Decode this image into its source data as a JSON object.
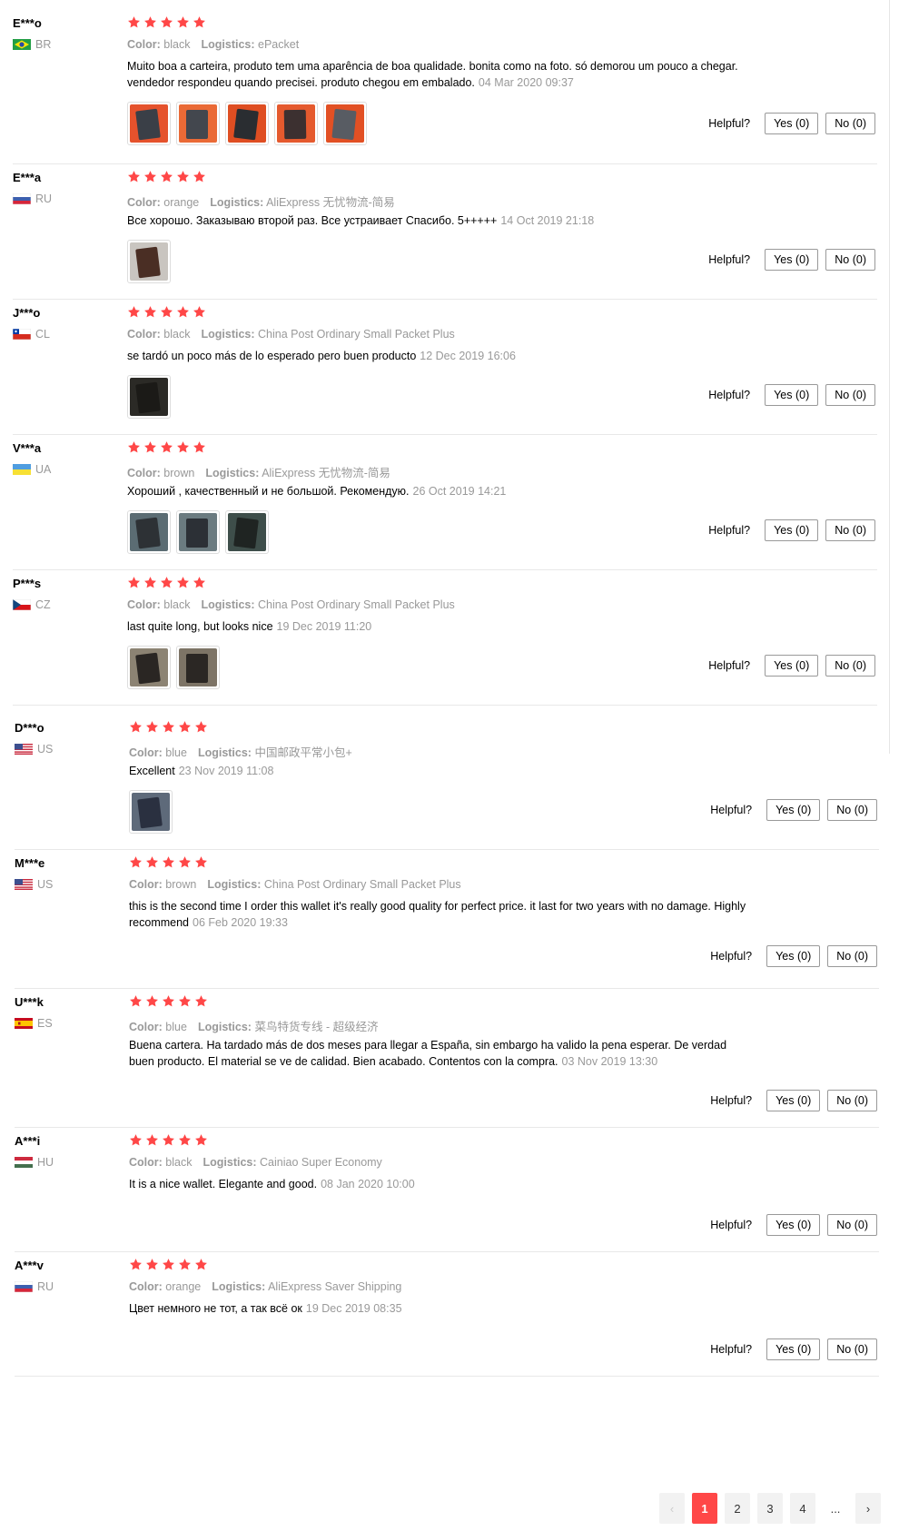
{
  "colors": {
    "accent": "#ff4747",
    "star": "#ff4747",
    "muted": "#999999"
  },
  "labels": {
    "color": "Color:",
    "logistics": "Logistics:",
    "helpful": "Helpful?"
  },
  "reviews": [
    {
      "user": "E***o",
      "country": "BR",
      "color": "black",
      "logistics": "ePacket",
      "text": "Muito boa a carteira, produto tem uma aparência de boa qualidade. bonita como na foto. só demorou um pouco a chegar. vendedor respondeu quando precisei. produto chegou em embalado.",
      "date": "04 Mar 2020 09:37",
      "photos": 5,
      "yes": "Yes (0)",
      "no": "No (0)",
      "rating": 5
    },
    {
      "user": "E***a",
      "country": "RU",
      "color": "orange",
      "logistics": "AliExpress 无忧物流-简易",
      "text": "Все хорошо. Заказываю второй раз. Все устраивает Спасибо. 5+++++",
      "date": "14 Oct 2019 21:18",
      "photos": 1,
      "yes": "Yes (0)",
      "no": "No (0)",
      "rating": 5
    },
    {
      "user": "J***o",
      "country": "CL",
      "color": "black",
      "logistics": "China Post Ordinary Small Packet Plus",
      "text": "se tardó un poco más de lo esperado pero buen producto",
      "date": "12 Dec 2019 16:06",
      "photos": 1,
      "yes": "Yes (0)",
      "no": "No (0)",
      "rating": 5
    },
    {
      "user": "V***a",
      "country": "UA",
      "color": "brown",
      "logistics": "AliExpress 无忧物流-简易",
      "text": "Хороший , качественный и не большой. Рекомендую.",
      "date": "26 Oct 2019 14:21",
      "photos": 3,
      "yes": "Yes (0)",
      "no": "No (0)",
      "rating": 5
    },
    {
      "user": "P***s",
      "country": "CZ",
      "color": "black",
      "logistics": "China Post Ordinary Small Packet Plus",
      "text": "last quite long, but looks nice",
      "date": "19 Dec 2019 11:20",
      "photos": 2,
      "yes": "Yes (0)",
      "no": "No (0)",
      "rating": 5
    },
    {
      "user": "D***o",
      "country": "US",
      "color": "blue",
      "logistics": "中国邮政平常小包+",
      "text": "Excellent",
      "date": "23 Nov 2019 11:08",
      "photos": 1,
      "yes": "Yes (0)",
      "no": "No (0)",
      "rating": 5
    },
    {
      "user": "M***e",
      "country": "US",
      "color": "brown",
      "logistics": "China Post Ordinary Small Packet Plus",
      "text": "this is the second time I order this wallet it's really good quality for perfect price. it last for two years with no damage. Highly recommend",
      "date": "06 Feb 2020 19:33",
      "photos": 0,
      "yes": "Yes (0)",
      "no": "No (0)",
      "rating": 5
    },
    {
      "user": "U***k",
      "country": "ES",
      "color": "blue",
      "logistics": "菜鸟特货专线 - 超级经济",
      "text": "Buena cartera. Ha tardado más de dos meses para llegar a España, sin embargo ha valido la pena esperar. De verdad buen producto. El material se ve de calidad. Bien acabado. Contentos con la compra.",
      "date": "03 Nov 2019 13:30",
      "photos": 0,
      "yes": "Yes (0)",
      "no": "No (0)",
      "rating": 5
    },
    {
      "user": "A***i",
      "country": "HU",
      "color": "black",
      "logistics": "Cainiao Super Economy",
      "text": "It is a nice wallet. Elegante and good.",
      "date": "08 Jan 2020 10:00",
      "photos": 0,
      "yes": "Yes (0)",
      "no": "No (0)",
      "rating": 5
    },
    {
      "user": "A***v",
      "country": "RU",
      "color": "orange",
      "logistics": "AliExpress Saver Shipping",
      "text": "Цвет немного не тот, а так всё ок",
      "date": "19 Dec 2019 08:35",
      "photos": 0,
      "yes": "Yes (0)",
      "no": "No (0)",
      "rating": 5
    }
  ],
  "pagination": {
    "prev": "‹",
    "pages": [
      "1",
      "2",
      "3",
      "4"
    ],
    "current": "1",
    "ellipsis": "...",
    "next": "›"
  }
}
